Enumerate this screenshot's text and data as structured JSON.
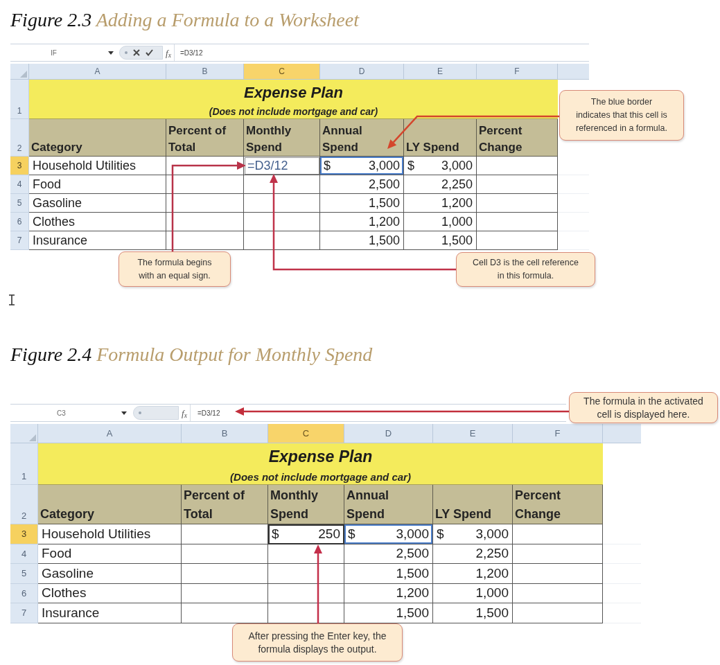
{
  "figures": [
    {
      "number": "Figure 2.3",
      "title": "Adding a Formula to a Worksheet",
      "spreadsheet": {
        "name_box": "IF",
        "editing": true,
        "function_label": "f$_{x}$",
        "formula": "=D3/12",
        "columns": [
          {
            "label": "A",
            "selected": false
          },
          {
            "label": "B",
            "selected": false
          },
          {
            "label": "C",
            "selected": true
          },
          {
            "label": "D",
            "selected": false
          },
          {
            "label": "E",
            "selected": false
          },
          {
            "label": "F",
            "selected": false
          }
        ],
        "title_row": {
          "number": "1",
          "title": "Expense Plan",
          "subtitle": "(Does not include mortgage and car)"
        },
        "header_row": {
          "number": "2",
          "headers": [
            {
              "lines": [
                "Category"
              ]
            },
            {
              "lines": [
                "Percent of",
                "Total"
              ]
            },
            {
              "lines": [
                "Monthly",
                "Spend"
              ]
            },
            {
              "lines": [
                "Annual",
                "Spend"
              ]
            },
            {
              "lines": [
                "LY Spend"
              ]
            },
            {
              "lines": [
                "Percent",
                "Change"
              ]
            }
          ]
        },
        "rows": [
          {
            "number": "3",
            "selected": true,
            "cells": [
              {
                "text": "Household Utilities",
                "selected": false,
                "referenced": false
              },
              {
                "selected": false,
                "referenced": false
              },
              {
                "text": "=D3/12",
                "selected": true,
                "referenced": false
              },
              {
                "symbol": "$",
                "text": "3,000",
                "selected": false,
                "referenced": true
              },
              {
                "symbol": "$",
                "text": "3,000",
                "selected": false,
                "referenced": false
              },
              {
                "selected": false,
                "referenced": false
              }
            ]
          },
          {
            "number": "4",
            "selected": false,
            "cells": [
              {
                "text": "Food",
                "selected": false,
                "referenced": false
              },
              {
                "selected": false,
                "referenced": false
              },
              {
                "selected": false,
                "referenced": false
              },
              {
                "text": "2,500",
                "selected": false,
                "referenced": false
              },
              {
                "text": "2,250",
                "selected": false,
                "referenced": false
              },
              {
                "selected": false,
                "referenced": false
              }
            ]
          },
          {
            "number": "5",
            "selected": false,
            "cells": [
              {
                "text": "Gasoline",
                "selected": false,
                "referenced": false
              },
              {
                "selected": false,
                "referenced": false
              },
              {
                "selected": false,
                "referenced": false
              },
              {
                "text": "1,500",
                "selected": false,
                "referenced": false
              },
              {
                "text": "1,200",
                "selected": false,
                "referenced": false
              },
              {
                "selected": false,
                "referenced": false
              }
            ]
          },
          {
            "number": "6",
            "selected": false,
            "cells": [
              {
                "text": "Clothes",
                "selected": false,
                "referenced": false
              },
              {
                "selected": false,
                "referenced": false
              },
              {
                "selected": false,
                "referenced": false
              },
              {
                "text": "1,200",
                "selected": false,
                "referenced": false
              },
              {
                "text": "1,000",
                "selected": false,
                "referenced": false
              },
              {
                "selected": false,
                "referenced": false
              }
            ]
          },
          {
            "number": "7",
            "selected": false,
            "cells": [
              {
                "text": "Insurance",
                "selected": false,
                "referenced": false
              },
              {
                "selected": false,
                "referenced": false
              },
              {
                "selected": false,
                "referenced": false
              },
              {
                "text": "1,500",
                "selected": false,
                "referenced": false
              },
              {
                "text": "1,500",
                "selected": false,
                "referenced": false
              },
              {
                "selected": false,
                "referenced": false
              }
            ]
          }
        ]
      },
      "callouts": [
        {
          "lines": [
            "The blue border",
            "indicates that this cell is",
            "referenced in a formula."
          ]
        },
        {
          "lines": [
            "The formula begins",
            "with an equal sign."
          ]
        },
        {
          "lines": [
            "Cell D3 is the cell reference",
            "in this formula."
          ]
        }
      ]
    },
    {
      "number": "Figure 2.4",
      "title": "Formula Output for Monthly Spend",
      "spreadsheet": {
        "name_box": "C3",
        "editing": false,
        "function_label": "f$_{x}$",
        "formula": "=D3/12",
        "columns": [
          {
            "label": "A",
            "selected": false
          },
          {
            "label": "B",
            "selected": false
          },
          {
            "label": "C",
            "selected": true
          },
          {
            "label": "D",
            "selected": false
          },
          {
            "label": "E",
            "selected": false
          },
          {
            "label": "F",
            "selected": false
          }
        ],
        "title_row": {
          "number": "1",
          "title": "Expense Plan",
          "subtitle": "(Does not include mortgage and car)"
        },
        "header_row": {
          "number": "2",
          "headers": [
            {
              "lines": [
                "Category"
              ]
            },
            {
              "lines": [
                "Percent of",
                "Total"
              ]
            },
            {
              "lines": [
                "Monthly",
                "Spend"
              ]
            },
            {
              "lines": [
                "Annual",
                "Spend"
              ]
            },
            {
              "lines": [
                "LY Spend"
              ]
            },
            {
              "lines": [
                "Percent",
                "Change"
              ]
            }
          ]
        },
        "rows": [
          {
            "number": "3",
            "selected": true,
            "cells": [
              {
                "text": "Household Utilities",
                "selected": false,
                "referenced": false
              },
              {
                "selected": false,
                "referenced": false
              },
              {
                "symbol": "$",
                "text": "250",
                "selected": true,
                "referenced": false
              },
              {
                "symbol": "$",
                "text": "3,000",
                "selected": false,
                "referenced": true
              },
              {
                "symbol": "$",
                "text": "3,000",
                "selected": false,
                "referenced": false
              },
              {
                "selected": false,
                "referenced": false
              }
            ]
          },
          {
            "number": "4",
            "selected": false,
            "cells": [
              {
                "text": "Food",
                "selected": false,
                "referenced": false
              },
              {
                "selected": false,
                "referenced": false
              },
              {
                "selected": false,
                "referenced": false
              },
              {
                "text": "2,500",
                "selected": false,
                "referenced": false
              },
              {
                "text": "2,250",
                "selected": false,
                "referenced": false
              },
              {
                "selected": false,
                "referenced": false
              }
            ]
          },
          {
            "number": "5",
            "selected": false,
            "cells": [
              {
                "text": "Gasoline",
                "selected": false,
                "referenced": false
              },
              {
                "selected": false,
                "referenced": false
              },
              {
                "selected": false,
                "referenced": false
              },
              {
                "text": "1,500",
                "selected": false,
                "referenced": false
              },
              {
                "text": "1,200",
                "selected": false,
                "referenced": false
              },
              {
                "selected": false,
                "referenced": false
              }
            ]
          },
          {
            "number": "6",
            "selected": false,
            "cells": [
              {
                "text": "Clothes",
                "selected": false,
                "referenced": false
              },
              {
                "selected": false,
                "referenced": false
              },
              {
                "selected": false,
                "referenced": false
              },
              {
                "text": "1,200",
                "selected": false,
                "referenced": false
              },
              {
                "text": "1,000",
                "selected": false,
                "referenced": false
              },
              {
                "selected": false,
                "referenced": false
              }
            ]
          },
          {
            "number": "7",
            "selected": false,
            "cells": [
              {
                "text": "Insurance",
                "selected": false,
                "referenced": false
              },
              {
                "selected": false,
                "referenced": false
              },
              {
                "selected": false,
                "referenced": false
              },
              {
                "text": "1,500",
                "selected": false,
                "referenced": false
              },
              {
                "text": "1,500",
                "selected": false,
                "referenced": false
              },
              {
                "selected": false,
                "referenced": false
              }
            ]
          }
        ]
      },
      "callouts": [
        {
          "lines": [
            "The formula in the activated",
            "cell is displayed here."
          ]
        },
        {
          "lines": [
            "After pressing the Enter key, the",
            "formula displays the output."
          ]
        }
      ]
    }
  ]
}
